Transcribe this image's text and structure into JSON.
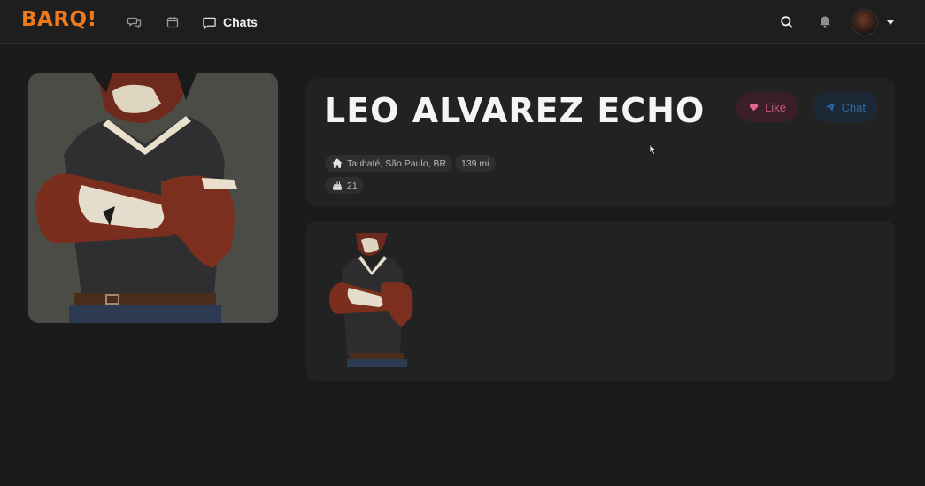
{
  "app": {
    "logo": "BARQ!"
  },
  "nav": {
    "icons": [
      "chat-bubbles-icon",
      "calendar-icon"
    ],
    "chats_label": "Chats"
  },
  "header_actions": [
    "search-icon",
    "bell-icon",
    "avatar",
    "chevron-down-icon"
  ],
  "profile": {
    "name": "Leo Alvarez Echo",
    "like_label": "Like",
    "chat_label": "Chat",
    "location": "Taubaté, São Paulo, BR",
    "distance": "139 mi",
    "age": "21"
  },
  "colors": {
    "brand": "#f07a1a",
    "like": "#c9567f",
    "chat": "#2f6aa6",
    "background": "#1b1b1b",
    "card": "#222222"
  }
}
